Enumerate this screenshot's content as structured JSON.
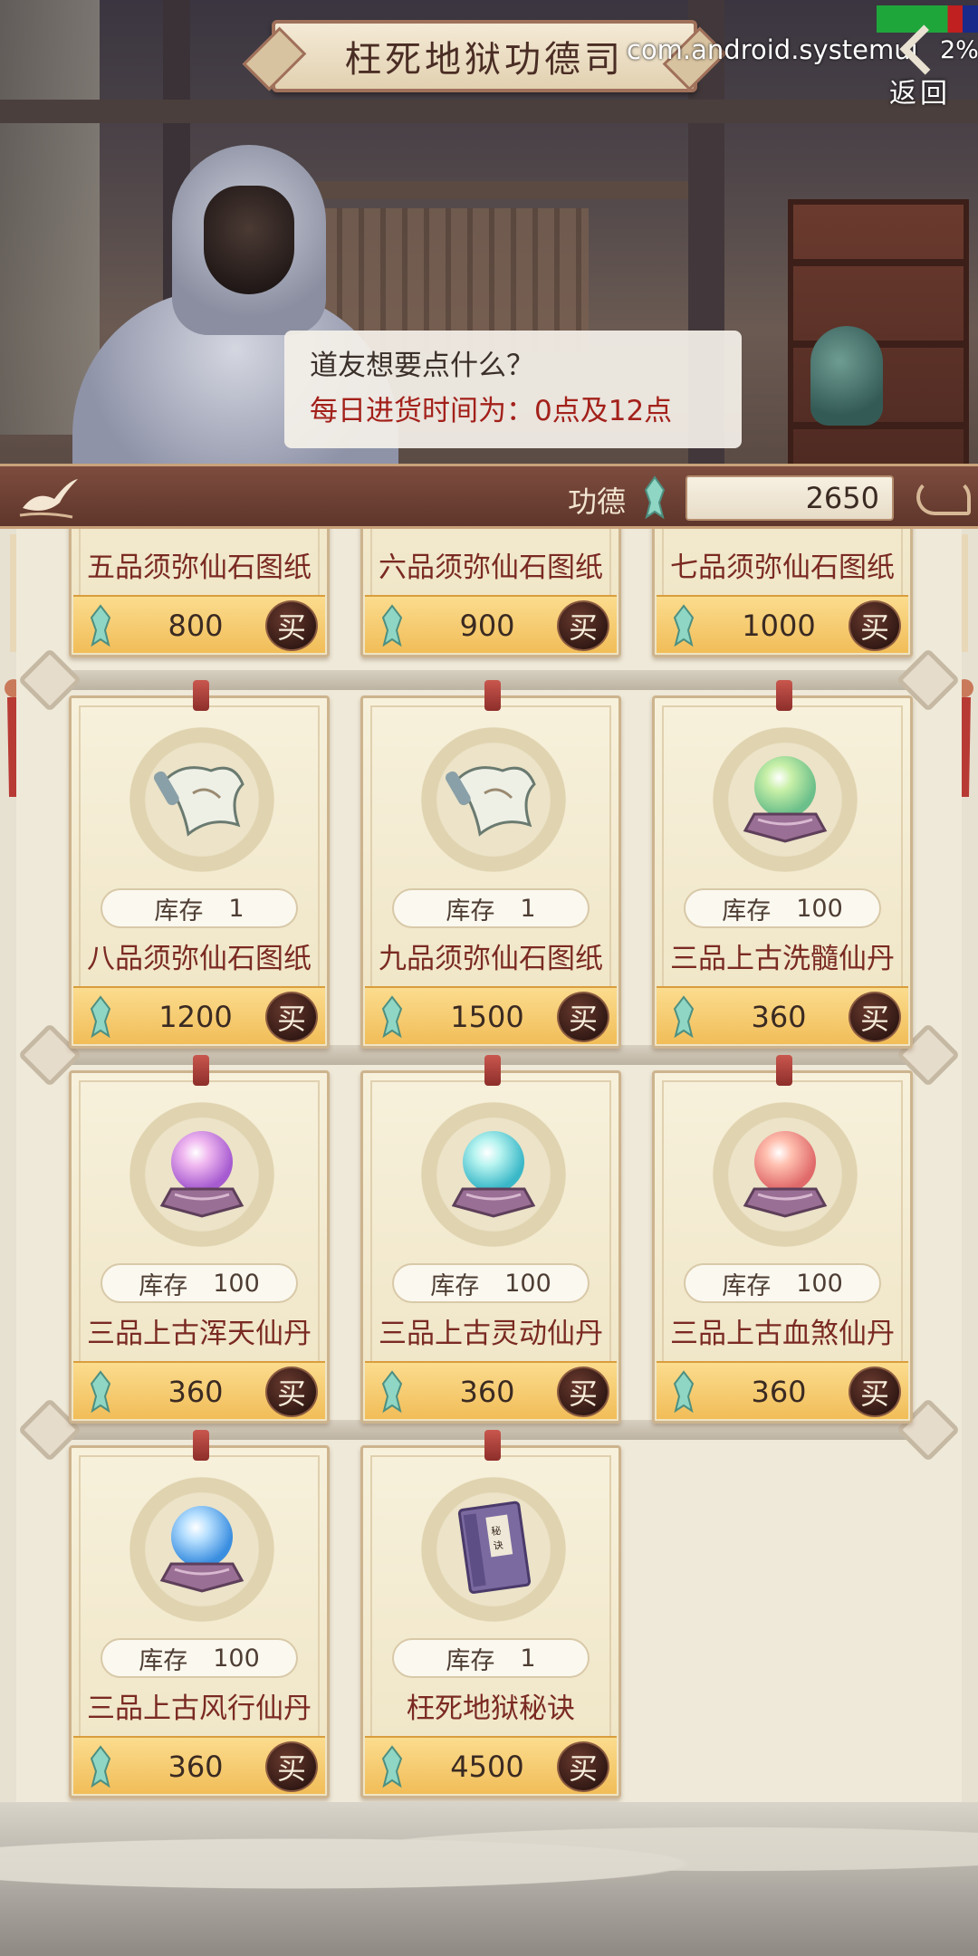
{
  "header": {
    "title": "枉死地狱功德司",
    "system_label": "com.android.systemui",
    "battery_pct": "2%",
    "back_label": "返回"
  },
  "dialog": {
    "line1": "道友想要点什么？",
    "line2": "每日进货时间为：0点及12点"
  },
  "merit": {
    "label": "功德",
    "value": "2650"
  },
  "stock_label": "库存",
  "buy_label": "买",
  "partial_row": [
    {
      "name": "五品须弥仙石图纸",
      "price": "800"
    },
    {
      "name": "六品须弥仙石图纸",
      "price": "900"
    },
    {
      "name": "七品须弥仙石图纸",
      "price": "1000"
    }
  ],
  "items": [
    {
      "name": "八品须弥仙石图纸",
      "stock": "1",
      "price": "1200",
      "icon": "scroll-icon"
    },
    {
      "name": "九品须弥仙石图纸",
      "stock": "1",
      "price": "1500",
      "icon": "scroll-icon"
    },
    {
      "name": "三品上古洗髓仙丹",
      "stock": "100",
      "price": "360",
      "icon": "green-orb-icon"
    },
    {
      "name": "三品上古浑天仙丹",
      "stock": "100",
      "price": "360",
      "icon": "purple-orb-icon"
    },
    {
      "name": "三品上古灵动仙丹",
      "stock": "100",
      "price": "360",
      "icon": "cyan-orb-icon"
    },
    {
      "name": "三品上古血煞仙丹",
      "stock": "100",
      "price": "360",
      "icon": "red-orb-icon"
    },
    {
      "name": "三品上古风行仙丹",
      "stock": "100",
      "price": "360",
      "icon": "blue-orb-icon"
    },
    {
      "name": "枉死地狱秘诀",
      "stock": "1",
      "price": "4500",
      "icon": "book-icon",
      "book_text": "秘诀"
    }
  ],
  "colors": {
    "name_text": "#7a2a22",
    "price_bar": "#f1bd58",
    "buy_button": "#2f1713",
    "dialog_highlight": "#a3201a"
  }
}
